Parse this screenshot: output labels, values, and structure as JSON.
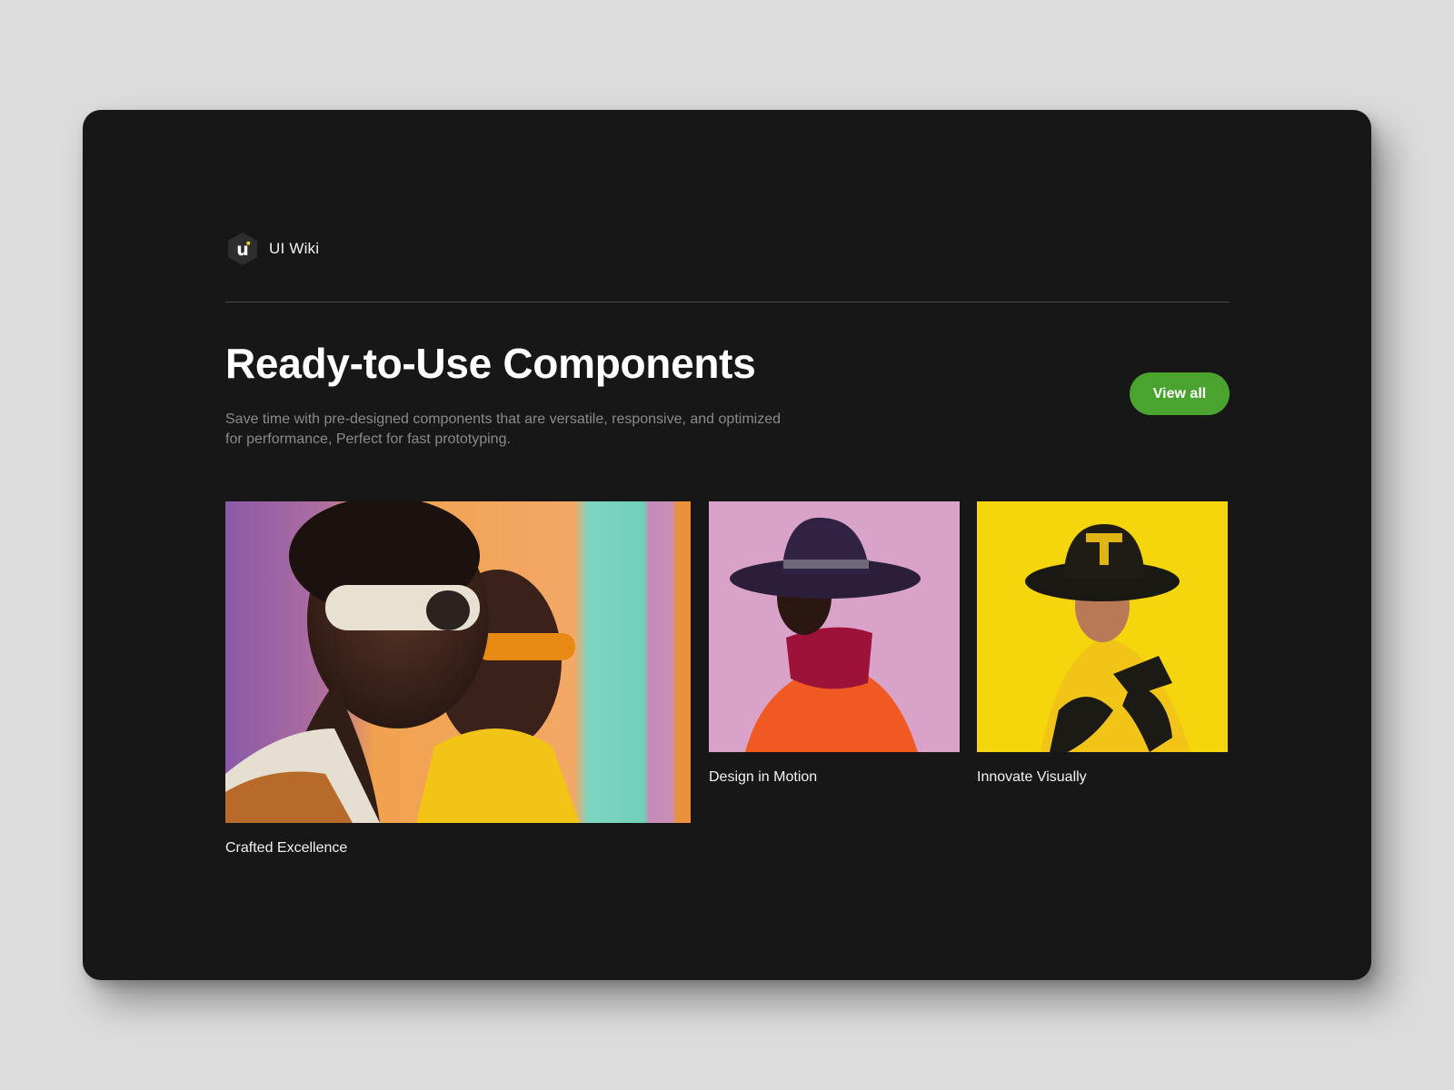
{
  "brand": {
    "name": "UI Wiki",
    "logo_letter": "u",
    "logo_icon": "ui-wiki-hexagon-logo"
  },
  "header": {
    "title": "Ready-to-Use Components",
    "subtitle": "Save time with pre-designed components that are versatile, responsive, and optimized for performance, Perfect for fast prototyping.",
    "view_all_label": "View all"
  },
  "tiles": [
    {
      "caption": "Crafted Excellence"
    },
    {
      "caption": "Design in Motion"
    },
    {
      "caption": "Innovate Visually"
    }
  ],
  "colors": {
    "page_background": "#dcdcdc",
    "card_background": "#171717",
    "accent_green": "#4aa32e",
    "logo_yellow": "#f5d90a"
  }
}
